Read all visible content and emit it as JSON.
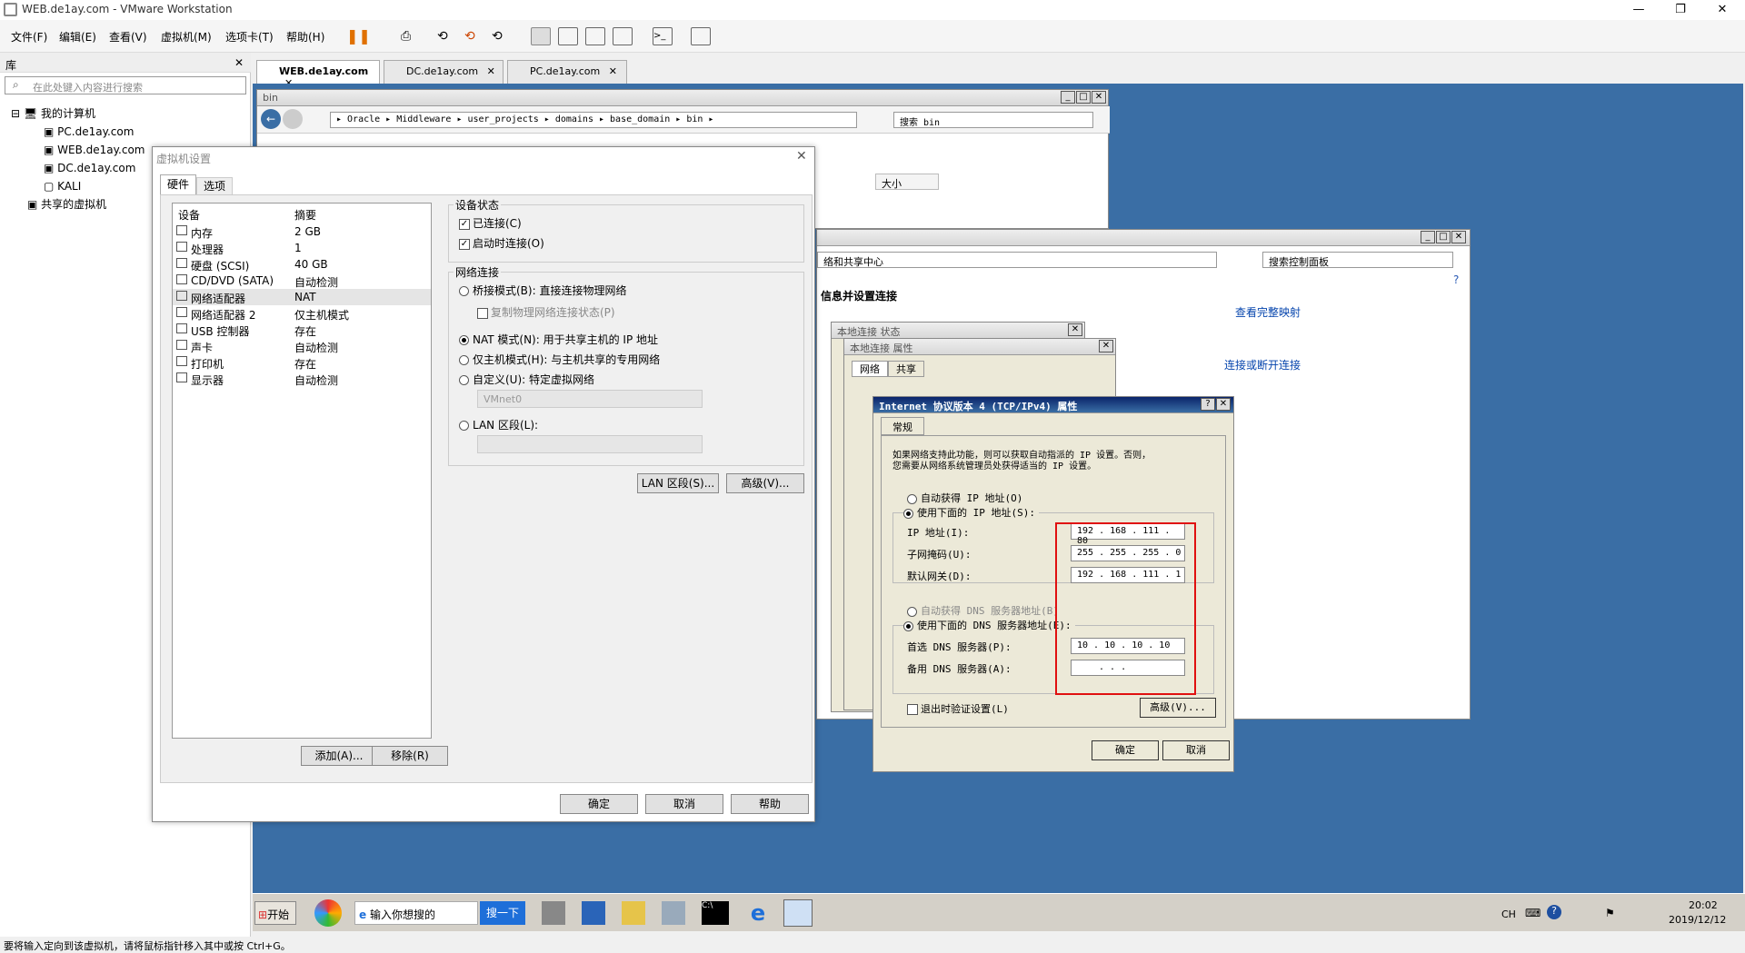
{
  "app": {
    "title": "WEB.de1ay.com - VMware Workstation"
  },
  "menu": [
    "文件(F)",
    "编辑(E)",
    "查看(V)",
    "虚拟机(M)",
    "选项卡(T)",
    "帮助(H)"
  ],
  "library": {
    "header": "库",
    "search_placeholder": "在此处键入内容进行搜索",
    "root": "我的计算机",
    "vms": [
      "PC.de1ay.com",
      "WEB.de1ay.com",
      "DC.de1ay.com",
      "KALI"
    ],
    "shared": "共享的虚拟机"
  },
  "tabs": [
    "WEB.de1ay.com",
    "DC.de1ay.com",
    "PC.de1ay.com"
  ],
  "explorer": {
    "title": "bin",
    "path": "▸ Oracle ▸ Middleware ▸ user_projects ▸ domains ▸ base_domain ▸ bin ▸",
    "search": "搜索 bin",
    "col_size": "大小"
  },
  "controlpanel": {
    "path": "络和共享中心",
    "search": "搜索控制面板",
    "heading": "信息并设置连接",
    "link1": "查看完整映射",
    "link2": "连接或断开连接"
  },
  "status_dialog": {
    "title": "本地连接 状态"
  },
  "props_dialog": {
    "title": "本地连接 属性",
    "tabs": [
      "网络",
      "共享"
    ]
  },
  "ipv4": {
    "title": "Internet 协议版本 4 (TCP/IPv4) 属性",
    "tab": "常规",
    "desc1": "如果网络支持此功能，则可以获取自动指派的 IP 设置。否则，",
    "desc2": "您需要从网络系统管理员处获得适当的 IP 设置。",
    "auto_ip": "自动获得 IP 地址(O)",
    "manual_ip": "使用下面的 IP 地址(S):",
    "ip_label": "IP 地址(I):",
    "ip": "192 . 168 . 111 . 80",
    "mask_label": "子网掩码(U):",
    "mask": "255 . 255 . 255 . 0",
    "gw_label": "默认网关(D):",
    "gw": "192 . 168 . 111 . 1",
    "auto_dns": "自动获得 DNS 服务器地址(B)",
    "manual_dns": "使用下面的 DNS 服务器地址(E):",
    "dns1_label": "首选 DNS 服务器(P):",
    "dns1": "10 . 10 . 10 . 10",
    "dns2_label": "备用 DNS 服务器(A):",
    "dns2": ".   .   .",
    "validate": "退出时验证设置(L)",
    "advanced": "高级(V)...",
    "ok": "确定",
    "cancel": "取消"
  },
  "vmset": {
    "title": "虚拟机设置",
    "tabs": [
      "硬件",
      "选项"
    ],
    "col_device": "设备",
    "col_summary": "摘要",
    "devices": [
      {
        "name": "内存",
        "summary": "2 GB"
      },
      {
        "name": "处理器",
        "summary": "1"
      },
      {
        "name": "硬盘 (SCSI)",
        "summary": "40 GB"
      },
      {
        "name": "CD/DVD (SATA)",
        "summary": "自动检测"
      },
      {
        "name": "网络适配器",
        "summary": "NAT"
      },
      {
        "name": "网络适配器 2",
        "summary": "仅主机模式"
      },
      {
        "name": "USB 控制器",
        "summary": "存在"
      },
      {
        "name": "声卡",
        "summary": "自动检测"
      },
      {
        "name": "打印机",
        "summary": "存在"
      },
      {
        "name": "显示器",
        "summary": "自动检测"
      }
    ],
    "add": "添加(A)...",
    "remove": "移除(R)",
    "device_status": "设备状态",
    "connected": "已连接(C)",
    "connect_on": "启动时连接(O)",
    "net_conn": "网络连接",
    "bridge": "桥接模式(B): 直接连接物理网络",
    "replicate": "复制物理网络连接状态(P)",
    "nat": "NAT 模式(N): 用于共享主机的 IP 地址",
    "host": "仅主机模式(H): 与主机共享的专用网络",
    "custom": "自定义(U): 特定虚拟网络",
    "vmnet": "VMnet0",
    "lan": "LAN 区段(L):",
    "lan_btn": "LAN 区段(S)...",
    "adv_btn": "高级(V)...",
    "ok": "确定",
    "cancel": "取消",
    "help": "帮助"
  },
  "taskbar": {
    "start": "开始",
    "search": "输入你想搜的",
    "search_btn": "搜一下",
    "lang": "CH",
    "time": "20:02",
    "date": "2019/12/12"
  },
  "statusbar": "要将输入定向到该虚拟机，请将鼠标指针移入其中或按 Ctrl+G。"
}
